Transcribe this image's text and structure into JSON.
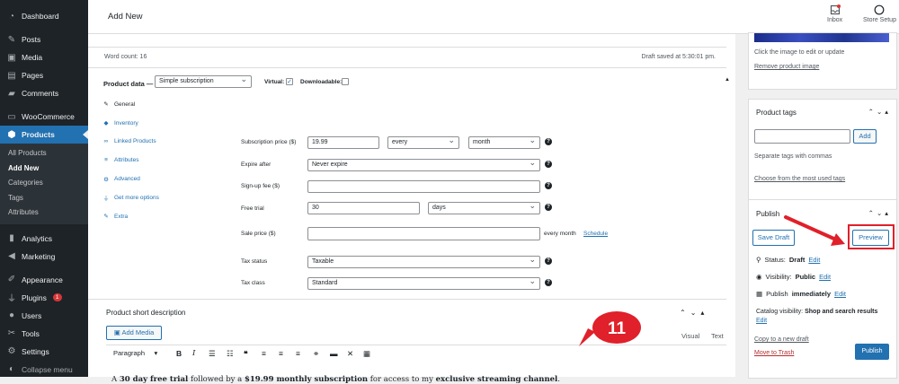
{
  "sidebar": {
    "items": [
      {
        "label": "Dashboard",
        "icon": "dashboard-icon"
      },
      {
        "label": "Posts",
        "icon": "pin-icon"
      },
      {
        "label": "Media",
        "icon": "media-icon"
      },
      {
        "label": "Pages",
        "icon": "page-icon"
      },
      {
        "label": "Comments",
        "icon": "comment-icon"
      },
      {
        "label": "WooCommerce",
        "icon": "woo-icon"
      },
      {
        "label": "Products",
        "icon": "products-icon"
      },
      {
        "label": "Analytics",
        "icon": "analytics-icon"
      },
      {
        "label": "Marketing",
        "icon": "megaphone-icon"
      },
      {
        "label": "Appearance",
        "icon": "brush-icon"
      },
      {
        "label": "Plugins",
        "icon": "plug-icon",
        "badge": "1"
      },
      {
        "label": "Users",
        "icon": "users-icon"
      },
      {
        "label": "Tools",
        "icon": "wrench-icon"
      },
      {
        "label": "Settings",
        "icon": "settings-icon"
      },
      {
        "label": "Collapse menu",
        "icon": "collapse-icon"
      }
    ],
    "sub_items": [
      "All Products",
      "Add New",
      "Categories",
      "Tags",
      "Attributes"
    ]
  },
  "header": {
    "title": "Add New",
    "inbox_label": "Inbox",
    "store_setup_label": "Store Setup"
  },
  "editor": {
    "word_count": "Word count: 16",
    "draft_saved": "Draft saved at 5:30:01 pm."
  },
  "product_data": {
    "title": "Product data —",
    "type_value": "Simple subscription",
    "virtual_label": "Virtual:",
    "virtual_checked": true,
    "downloadable_label": "Downloadable:",
    "downloadable_checked": false,
    "tabs": [
      {
        "label": "General",
        "icon": "wrench-icon"
      },
      {
        "label": "Inventory",
        "icon": "diamond-icon"
      },
      {
        "label": "Linked Products",
        "icon": "link-icon"
      },
      {
        "label": "Attributes",
        "icon": "list-icon"
      },
      {
        "label": "Advanced",
        "icon": "gear-icon"
      },
      {
        "label": "Get more options",
        "icon": "plug-icon"
      },
      {
        "label": "Extra",
        "icon": "wrench-icon"
      }
    ],
    "fields": {
      "subscription_price_label": "Subscription price ($)",
      "subscription_price_value": "19.99",
      "interval_value": "every",
      "period_value": "month",
      "expire_after_label": "Expire after",
      "expire_after_value": "Never expire",
      "signup_fee_label": "Sign-up fee ($)",
      "signup_fee_value": "",
      "free_trial_label": "Free trial",
      "free_trial_value": "30",
      "free_trial_period": "days",
      "sale_price_label": "Sale price ($)",
      "sale_price_value": "",
      "sale_price_suffix": "every month",
      "schedule_link": "Schedule",
      "tax_status_label": "Tax status",
      "tax_status_value": "Taxable",
      "tax_class_label": "Tax class",
      "tax_class_value": "Standard"
    }
  },
  "short_description": {
    "title": "Product short description",
    "add_media": "Add Media",
    "visual_tab": "Visual",
    "text_tab": "Text",
    "paragraph_value": "Paragraph",
    "content": {
      "p1": "A ",
      "b1": "30 day free trial",
      "p2": " followed by a ",
      "b2": "$19.99 monthly subscription",
      "p3": " for access to my ",
      "b3": "exclusive streaming channel",
      "p4": "."
    }
  },
  "product_image": {
    "hint": "Click the image to edit or update",
    "remove_link": "Remove product image"
  },
  "product_tags": {
    "title": "Product tags",
    "input_value": "",
    "add_button": "Add",
    "help": "Separate tags with commas",
    "choose_link": "Choose from the most used tags"
  },
  "publish": {
    "title": "Publish",
    "save_draft": "Save Draft",
    "preview": "Preview",
    "status_label": "Status:",
    "status_value": "Draft",
    "visibility_label": "Visibility:",
    "visibility_value": "Public",
    "publish_label": "Publish",
    "publish_value": "immediately",
    "edit_link": "Edit",
    "catalog_label": "Catalog visibility:",
    "catalog_value": "Shop and search results",
    "copy_link": "Copy to a new draft",
    "trash_link": "Move to Trash",
    "publish_button": "Publish"
  },
  "annotation": {
    "step_number": "11",
    "highlight_color": "#e0202a"
  },
  "colors": {
    "admin_bar": "#1d2327",
    "accent": "#2271b1",
    "annotation": "#e0202a"
  }
}
